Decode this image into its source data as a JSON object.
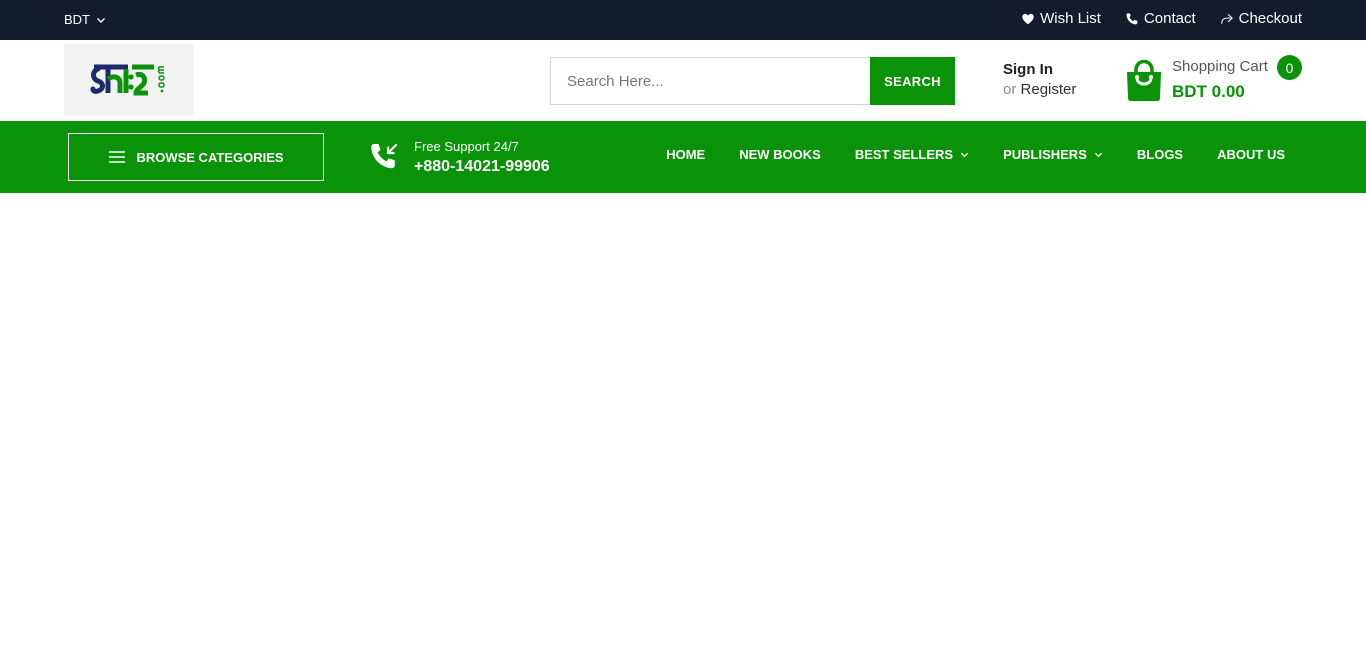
{
  "topbar": {
    "currency": "BDT",
    "links": [
      {
        "label": "Wish List",
        "icon": "heart-icon"
      },
      {
        "label": "Contact",
        "icon": "phone-icon"
      },
      {
        "label": "Checkout",
        "icon": "share-arrow-icon"
      }
    ]
  },
  "header": {
    "logo_alt": "boimela.com logo",
    "search": {
      "placeholder": "Search Here...",
      "button_label": "SEARCH"
    },
    "account": {
      "signin_label": "Sign In",
      "or_text": "or",
      "register_label": "Register"
    },
    "cart": {
      "label": "Shopping Cart",
      "count": "0",
      "total": "BDT 0.00"
    }
  },
  "navbar": {
    "browse_label": "BROWSE CATEGORIES",
    "support": {
      "label": "Free Support 24/7",
      "phone": "+880-14021-99906"
    },
    "menu": [
      {
        "label": "HOME",
        "dropdown": false
      },
      {
        "label": "NEW BOOKS",
        "dropdown": false
      },
      {
        "label": "BEST SELLERS",
        "dropdown": true
      },
      {
        "label": "PUBLISHERS",
        "dropdown": true
      },
      {
        "label": "BLOGS",
        "dropdown": false
      },
      {
        "label": "ABOUT US",
        "dropdown": false
      }
    ]
  },
  "colors": {
    "topbar_bg": "#141b2d",
    "brand_green": "#0a9208",
    "logo_navy": "#1b2a6b"
  }
}
